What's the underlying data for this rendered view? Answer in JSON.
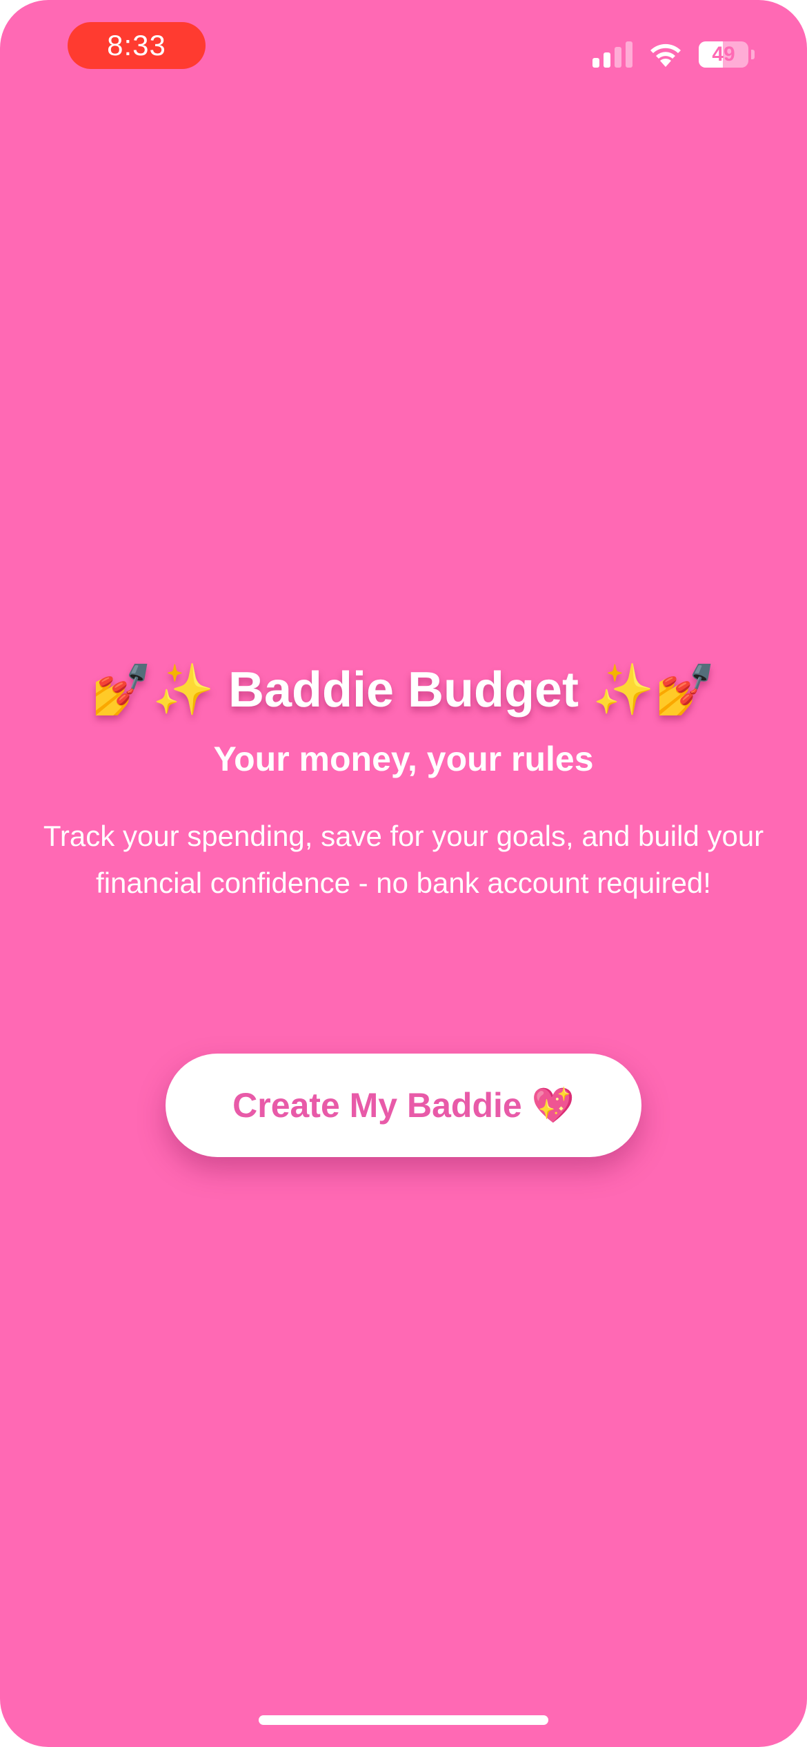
{
  "status_bar": {
    "time": "8:33",
    "battery": "49",
    "signal_icon": "cellular-signal-icon",
    "wifi_icon": "wifi-icon",
    "battery_icon": "battery-icon"
  },
  "onboarding": {
    "title": "💅✨ Baddie Budget ✨💅",
    "subtitle": "Your money, your rules",
    "description": "Track your spending, save for your goals, and build your financial confidence - no bank account required!",
    "cta_label": "Create My Baddie 💖"
  },
  "colors": {
    "background": "#ff69b4",
    "button_background": "#ffffff",
    "button_text": "#e85aa8",
    "time_pill": "#ff3b30"
  }
}
